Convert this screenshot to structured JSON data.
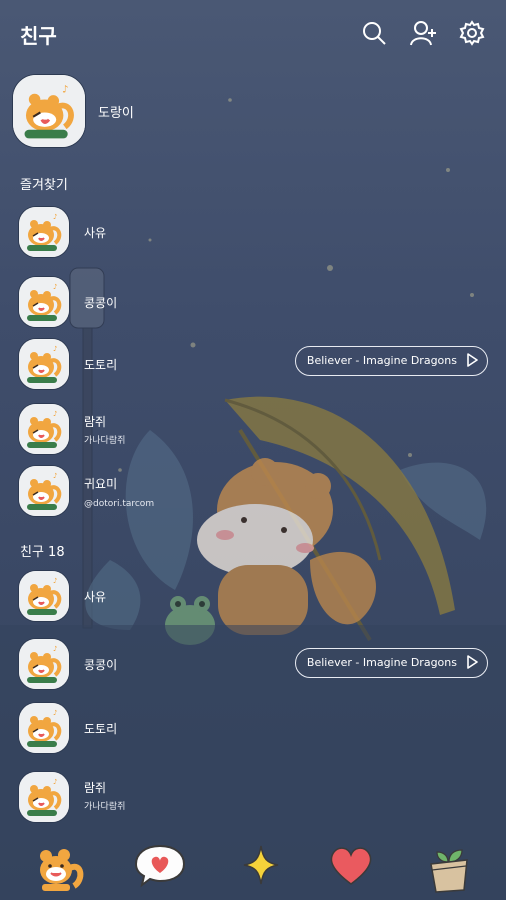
{
  "header": {
    "title": "친구"
  },
  "icons": {
    "search": "search-icon",
    "add_friend": "add-friend-icon",
    "settings": "gear-icon",
    "play": "play-icon"
  },
  "my_profile": {
    "name": "도랑이"
  },
  "favorites": {
    "label": "즐겨찾기",
    "items": [
      {
        "name": "사유",
        "status": "",
        "music": ""
      },
      {
        "name": "콩콩이",
        "status": "",
        "music": ""
      },
      {
        "name": "도토리",
        "status": "",
        "music": "Believer - Imagine Dragons"
      },
      {
        "name": "람쥐",
        "status": "가나다람쥐",
        "music": ""
      },
      {
        "name": "귀요미",
        "status": "@dotori.tarcom",
        "music": ""
      }
    ]
  },
  "friends": {
    "label": "친구 18",
    "items": [
      {
        "name": "사유",
        "status": "",
        "music": ""
      },
      {
        "name": "콩콩이",
        "status": "",
        "music": "Believer - Imagine Dragons"
      },
      {
        "name": "도토리",
        "status": "",
        "music": ""
      },
      {
        "name": "람쥐",
        "status": "가나다람쥐",
        "music": ""
      }
    ]
  },
  "tabbar": {
    "tabs": [
      {
        "icon": "squirrel-friends-icon"
      },
      {
        "icon": "heart-speech-bubble-icon"
      },
      {
        "icon": "sparkle-icon"
      },
      {
        "icon": "heart-icon"
      },
      {
        "icon": "plant-pot-icon"
      }
    ]
  },
  "colors": {
    "background": "#3f4d6b",
    "text": "#ffffff",
    "umbrella": "#8a7a3e",
    "squirrel": "#c48a4a"
  }
}
